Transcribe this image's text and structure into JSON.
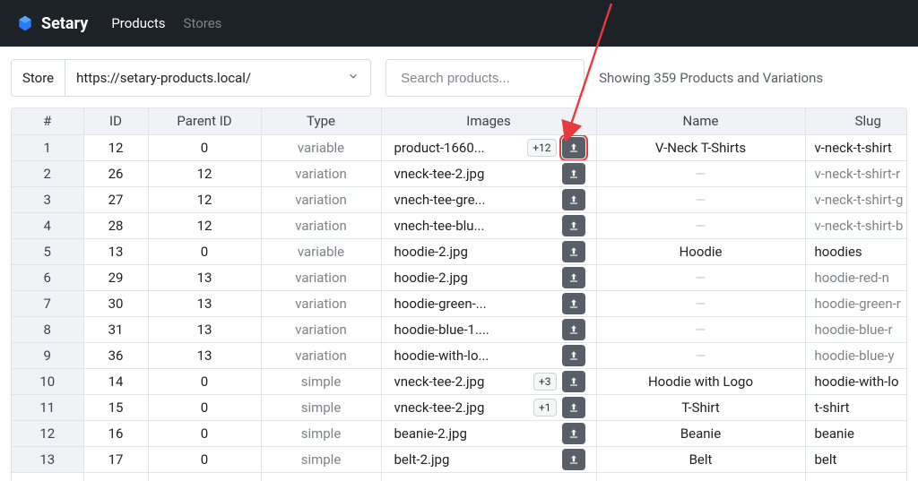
{
  "brand": {
    "name": "Setary"
  },
  "nav": {
    "products": "Products",
    "stores": "Stores"
  },
  "toolbar": {
    "store_label": "Store",
    "store_value": "https://setary-products.local/",
    "search_placeholder": "Search products...",
    "status": "Showing 359 Products and Variations"
  },
  "table": {
    "headers": {
      "num": "#",
      "id": "ID",
      "parent": "Parent ID",
      "type": "Type",
      "images": "Images",
      "name": "Name",
      "slug": "Slug"
    },
    "rows": [
      {
        "num": "1",
        "id": "12",
        "parent": "0",
        "type": "variable",
        "image": "product-1660...",
        "extra": "+12",
        "highlight": true,
        "name": "V-Neck T-Shirts",
        "slug": "v-neck-t-shirt",
        "slug_active": true
      },
      {
        "num": "2",
        "id": "26",
        "parent": "12",
        "type": "variation",
        "image": "vneck-tee-2.jpg",
        "extra": "",
        "highlight": false,
        "name": "",
        "slug": "v-neck-t-shirt-r",
        "slug_active": false
      },
      {
        "num": "3",
        "id": "27",
        "parent": "12",
        "type": "variation",
        "image": "vnech-tee-gre...",
        "extra": "",
        "highlight": false,
        "name": "",
        "slug": "v-neck-t-shirt-g",
        "slug_active": false
      },
      {
        "num": "4",
        "id": "28",
        "parent": "12",
        "type": "variation",
        "image": "vnech-tee-blu...",
        "extra": "",
        "highlight": false,
        "name": "",
        "slug": "v-neck-t-shirt-b",
        "slug_active": false
      },
      {
        "num": "5",
        "id": "13",
        "parent": "0",
        "type": "variable",
        "image": "hoodie-2.jpg",
        "extra": "",
        "highlight": false,
        "name": "Hoodie",
        "slug": "hoodies",
        "slug_active": true
      },
      {
        "num": "6",
        "id": "29",
        "parent": "13",
        "type": "variation",
        "image": "hoodie-2.jpg",
        "extra": "",
        "highlight": false,
        "name": "",
        "slug": "hoodie-red-n",
        "slug_active": false
      },
      {
        "num": "7",
        "id": "30",
        "parent": "13",
        "type": "variation",
        "image": "hoodie-green-...",
        "extra": "",
        "highlight": false,
        "name": "",
        "slug": "hoodie-green-r",
        "slug_active": false
      },
      {
        "num": "8",
        "id": "31",
        "parent": "13",
        "type": "variation",
        "image": "hoodie-blue-1....",
        "extra": "",
        "highlight": false,
        "name": "",
        "slug": "hoodie-blue-r",
        "slug_active": false
      },
      {
        "num": "9",
        "id": "36",
        "parent": "13",
        "type": "variation",
        "image": "hoodie-with-lo...",
        "extra": "",
        "highlight": false,
        "name": "",
        "slug": "hoodie-blue-y",
        "slug_active": false
      },
      {
        "num": "10",
        "id": "14",
        "parent": "0",
        "type": "simple",
        "image": "vneck-tee-2.jpg",
        "extra": "+3",
        "highlight": false,
        "name": "Hoodie with Logo",
        "slug": "hoodie-with-lo",
        "slug_active": true
      },
      {
        "num": "11",
        "id": "15",
        "parent": "0",
        "type": "simple",
        "image": "vneck-tee-2.jpg",
        "extra": "+1",
        "highlight": false,
        "name": "T-Shirt",
        "slug": "t-shirt",
        "slug_active": true
      },
      {
        "num": "12",
        "id": "16",
        "parent": "0",
        "type": "simple",
        "image": "beanie-2.jpg",
        "extra": "",
        "highlight": false,
        "name": "Beanie",
        "slug": "beanie",
        "slug_active": true
      },
      {
        "num": "13",
        "id": "17",
        "parent": "0",
        "type": "simple",
        "image": "belt-2.jpg",
        "extra": "",
        "highlight": false,
        "name": "Belt",
        "slug": "belt",
        "slug_active": true
      }
    ]
  }
}
